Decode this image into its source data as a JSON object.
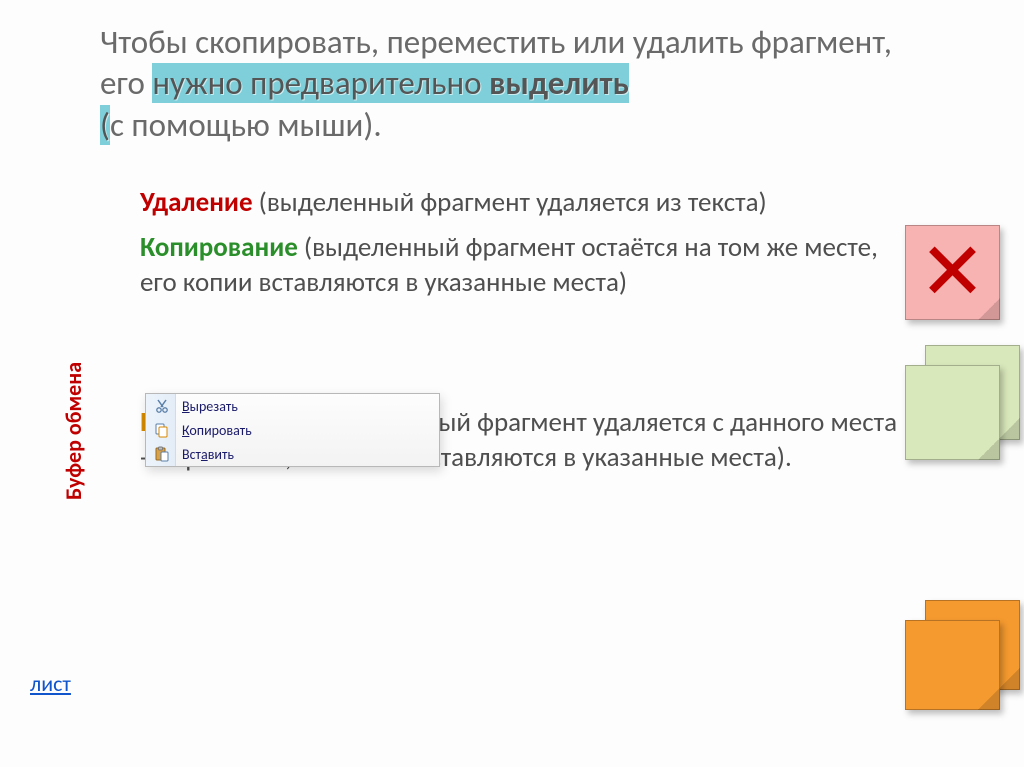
{
  "title": {
    "prefix": "Чтобы скопировать, переместить или удалить фрагмент, его ",
    "highlighted": "нужно предварительно ",
    "highlighted_bold": "выделить",
    "suffix_open": "(",
    "suffix": "с помощью мыши)."
  },
  "sections": {
    "delete": {
      "term": "Удаление",
      "text": " (выделенный фрагмент удаляется из текста)"
    },
    "copy": {
      "term": "Копирование",
      "text": " (выделенный фрагмент остаётся на том же месте,  его копии вставляются в указанные места)"
    },
    "move": {
      "term": "Перемещение",
      "text": " (выделенный фрагмент удаляется с данного места -  вырезается, его копии вставляются в указанные места)."
    }
  },
  "context_menu": {
    "cut": {
      "mnemonic": "В",
      "rest": "ырезать"
    },
    "copy": {
      "mnemonic": "К",
      "rest": "опировать"
    },
    "paste": {
      "prefix": "Вст",
      "mnemonic": "а",
      "rest": "вить"
    }
  },
  "sidebar": {
    "rotated_label": "Буфер обмена",
    "link": "лист"
  },
  "cards": {
    "delete_symbol": "✕"
  }
}
